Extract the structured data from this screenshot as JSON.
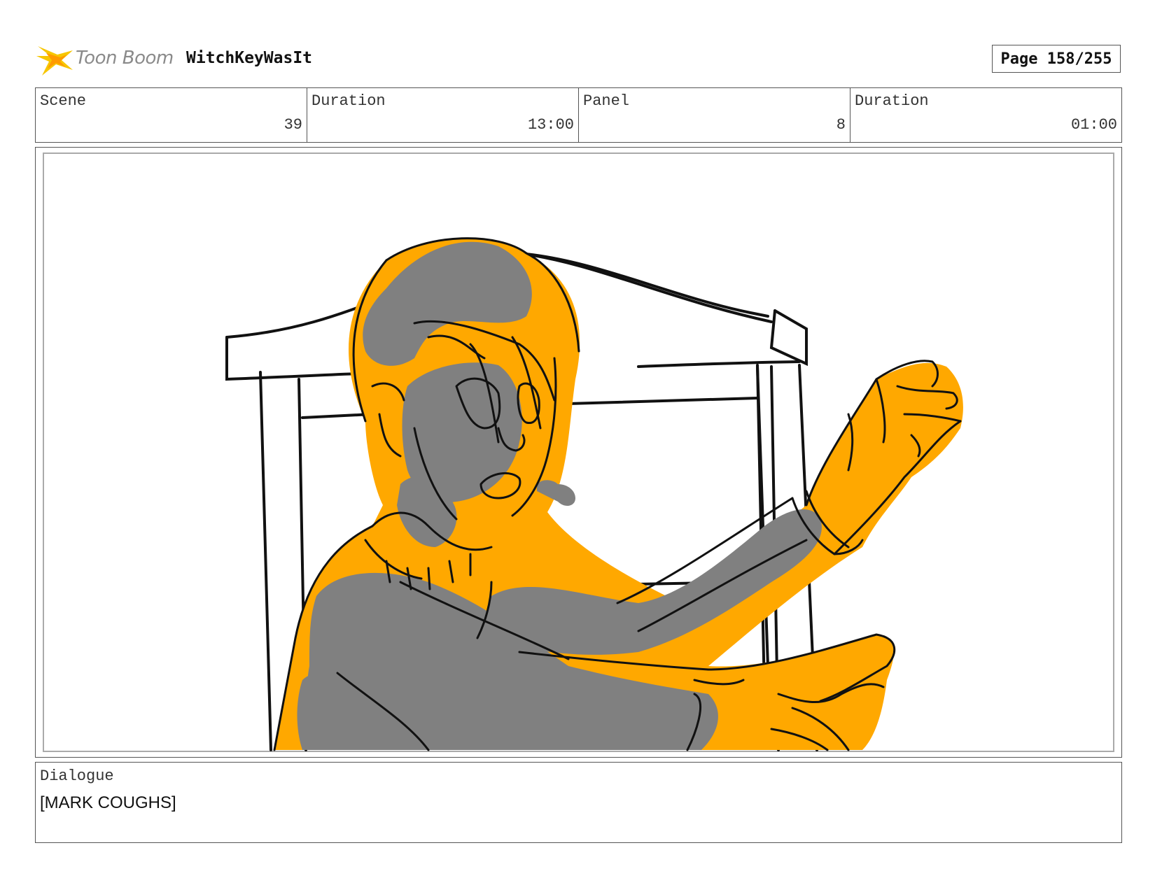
{
  "header": {
    "logo_text": "Toon Boom",
    "project_title": "WitchKeyWasIt",
    "page_label": "Page 158/255"
  },
  "info": {
    "scene_label": "Scene",
    "scene_value": "39",
    "scene_duration_label": "Duration",
    "scene_duration_value": "13:00",
    "panel_label": "Panel",
    "panel_value": "8",
    "panel_duration_label": "Duration",
    "panel_duration_value": "01:00"
  },
  "dialogue": {
    "label": "Dialogue",
    "text": "[MARK COUGHS]"
  },
  "colors": {
    "fill_orange": "#ffa800",
    "shade_gray": "#808080",
    "line": "#111111"
  }
}
